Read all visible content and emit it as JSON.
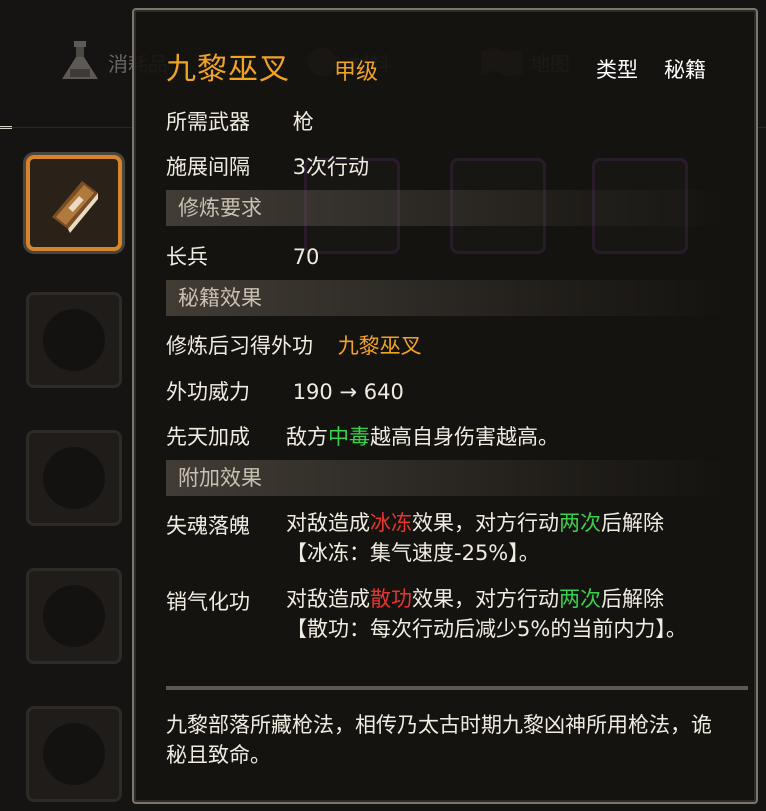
{
  "tabs": {
    "consumables": "消耗品",
    "materials": "材料",
    "map": "地图"
  },
  "tooltip": {
    "title": "九黎巫叉",
    "grade": "甲级",
    "type_label": "类型",
    "type_value": "秘籍",
    "weapon_label": "所需武器",
    "weapon_value": "枪",
    "interval_label": "施展间隔",
    "interval_value": "3次行动",
    "req_header": "修炼要求",
    "req_label": "长兵",
    "req_value": "70",
    "effect_header": "秘籍效果",
    "learn_label": "修炼后习得外功",
    "learn_value": "九黎巫叉",
    "power_label": "外功威力",
    "power_value": "190 → 640",
    "innate_label": "先天加成",
    "innate_pre": "敌方",
    "innate_hl": "中毒",
    "innate_post": "越高自身伤害越高。",
    "extra_header": "附加效果",
    "extra1": {
      "name": "失魂落魄",
      "t1": "对敌造成",
      "t2": "冰冻",
      "t3": "效果，对方行动",
      "t4": "两次",
      "t5": "后解除",
      "t6": "【冰冻：集气速度-25%】。"
    },
    "extra2": {
      "name": "销气化功",
      "t1": "对敌造成",
      "t2": "散功",
      "t3": "效果，对方行动",
      "t4": "两次",
      "t5": "后解除",
      "t6": "【散功：每次行动后减少5%的当前内力】。"
    },
    "description": "九黎部落所藏枪法，相传乃太古时期九黎凶神所用枪法，诡秘且致命。"
  },
  "colors": {
    "gold": "#f0a321",
    "green": "#38d24a",
    "red": "#e8332e",
    "selected_border": "#d7852a"
  },
  "icons": {
    "consumables": "potion-icon",
    "materials": "material-icon",
    "map": "map-icon",
    "item": "book-icon"
  }
}
